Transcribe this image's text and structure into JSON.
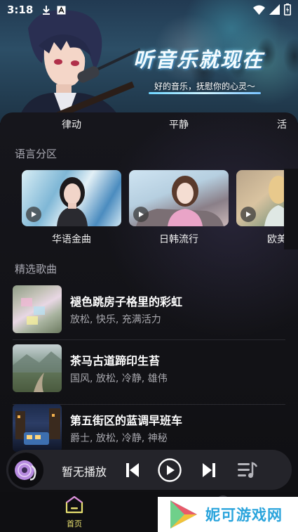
{
  "status_bar": {
    "time": "3:18",
    "icons": [
      "download-icon",
      "a-box-icon",
      "wifi-icon",
      "signal-icon",
      "battery-icon"
    ]
  },
  "hero": {
    "title": "听音乐就现在",
    "subtitle": "好的音乐，抚慰你的心灵～"
  },
  "tabs": [
    "律动",
    "平静",
    "活"
  ],
  "language_section": {
    "title": "语言分区",
    "cards": [
      {
        "label": "华语金曲"
      },
      {
        "label": "日韩流行"
      },
      {
        "label": "欧美"
      }
    ]
  },
  "songs_section": {
    "title": "精选歌曲",
    "songs": [
      {
        "title": "褪色跳房子格里的彩虹",
        "tags": "放松, 快乐, 充满活力"
      },
      {
        "title": "茶马古道蹄印生苔",
        "tags": "国风, 放松, 冷静, 雄伟"
      },
      {
        "title": "第五街区的蓝调早班车",
        "tags": "爵士, 放松, 冷静, 神秘"
      }
    ]
  },
  "player": {
    "status_text": "暂无播放",
    "icons": [
      "previous-icon",
      "play-icon",
      "next-icon",
      "playlist-icon"
    ]
  },
  "nav": {
    "home_label": "首页"
  },
  "watermark": {
    "text": "妮可游戏网"
  },
  "colors": {
    "accent_yellow": "#e8e070",
    "background": "#0e0e12",
    "player_bg": "#24242a",
    "tag_gray": "#a8a8ae"
  }
}
